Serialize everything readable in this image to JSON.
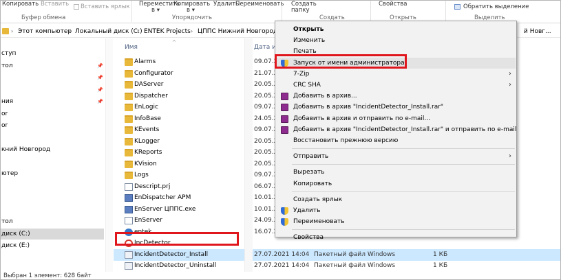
{
  "ribbon": {
    "items": [
      {
        "text": "Копировать",
        "grey": false
      },
      {
        "text": "Вставить",
        "grey": true
      },
      {
        "text": "Вставить ярлык",
        "grey": true
      },
      {
        "text": "Переместить",
        "grey": false
      },
      {
        "text": "Копировать",
        "grey": false
      },
      {
        "text": "в ▾",
        "grey": false
      },
      {
        "text": "в ▾",
        "grey": false
      },
      {
        "text": "Удалить",
        "grey": false
      },
      {
        "text": "Переименовать",
        "grey": false
      },
      {
        "text": "Создать",
        "grey": false
      },
      {
        "text": "папку",
        "grey": false
      },
      {
        "text": "Свойства",
        "grey": false
      },
      {
        "text": "Обратить выделение",
        "grey": false
      }
    ],
    "groups": [
      "Буфер обмена",
      "Упорядочить",
      "Создать",
      "Открыть",
      "Выделить"
    ]
  },
  "address": {
    "crumbs": [
      "Этот компьютер",
      "Локальный диск (C:)",
      "ENTEK Projects",
      "ЦППС Нижний Новгород"
    ],
    "right_text": "й Новг..."
  },
  "nav": {
    "items": [
      {
        "label": "ступ",
        "pinned": false,
        "selected": false
      },
      {
        "label": "тол",
        "pinned": true,
        "selected": false
      },
      {
        "label": "",
        "pinned": true,
        "selected": false
      },
      {
        "label": "",
        "pinned": true,
        "selected": false
      },
      {
        "label": "ния",
        "pinned": true,
        "selected": false
      },
      {
        "label": "or",
        "pinned": false,
        "selected": false
      },
      {
        "label": "or",
        "pinned": false,
        "selected": false
      },
      {
        "label": "",
        "pinned": false,
        "selected": false
      },
      {
        "label": "кний Новгород",
        "pinned": false,
        "selected": false
      },
      {
        "label": "",
        "pinned": false,
        "selected": false
      },
      {
        "label": "ютер",
        "pinned": false,
        "selected": false
      },
      {
        "label": "",
        "pinned": false,
        "selected": false
      },
      {
        "label": "",
        "pinned": false,
        "selected": false
      },
      {
        "label": "",
        "pinned": false,
        "selected": false
      },
      {
        "label": "тол",
        "pinned": false,
        "selected": false
      },
      {
        "label": "диск (C:)",
        "pinned": false,
        "selected": true
      },
      {
        "label": "диск (E:)",
        "pinned": false,
        "selected": false
      }
    ]
  },
  "list": {
    "columns": {
      "name": "Имя",
      "date": "Дата из"
    },
    "rows": [
      {
        "name": "Alarms",
        "date": "09.07.20",
        "type": "",
        "size": "",
        "icon": "folder"
      },
      {
        "name": "Configurator",
        "date": "21.07.20",
        "type": "",
        "size": "",
        "icon": "folder"
      },
      {
        "name": "DAServer",
        "date": "20.05.20",
        "type": "",
        "size": "",
        "icon": "folder"
      },
      {
        "name": "Dispatcher",
        "date": "20.05.20",
        "type": "",
        "size": "",
        "icon": "folder"
      },
      {
        "name": "EnLogic",
        "date": "09.07.20",
        "type": "",
        "size": "",
        "icon": "folder"
      },
      {
        "name": "InfoBase",
        "date": "24.05.20",
        "type": "",
        "size": "",
        "icon": "folder"
      },
      {
        "name": "KEvents",
        "date": "09.07.20",
        "type": "",
        "size": "",
        "icon": "folder"
      },
      {
        "name": "KLogger",
        "date": "20.05.20",
        "type": "",
        "size": "",
        "icon": "folder"
      },
      {
        "name": "KReports",
        "date": "20.05.20",
        "type": "",
        "size": "",
        "icon": "folder"
      },
      {
        "name": "KVision",
        "date": "20.05.20",
        "type": "",
        "size": "",
        "icon": "folder"
      },
      {
        "name": "Logs",
        "date": "09.07.20",
        "type": "",
        "size": "",
        "icon": "folder"
      },
      {
        "name": "Descript.prj",
        "date": "06.07.20",
        "type": "",
        "size": "",
        "icon": "doc"
      },
      {
        "name": "EnDispatcher APM",
        "date": "10.01.20",
        "type": "",
        "size": "",
        "icon": "exe"
      },
      {
        "name": "EnServer ЦППС.exe",
        "date": "10.01.20",
        "type": "",
        "size": "",
        "icon": "exe"
      },
      {
        "name": "EnServer",
        "date": "24.09.20",
        "type": "",
        "size": "",
        "icon": "doc"
      },
      {
        "name": "entek",
        "date": "16.07.20",
        "type": "",
        "size": "",
        "icon": "blue"
      },
      {
        "name": "IncDetector",
        "date": "",
        "type": "",
        "size": "",
        "icon": "red"
      },
      {
        "name": "IncidentDetector_Install",
        "date": "27.07.2021 14:04",
        "type": "Пакетный файл Windows",
        "size": "1 КБ",
        "icon": "bat",
        "highlight": true
      },
      {
        "name": "IncidentDetector_Uninstall",
        "date": "27.07.2021 14:04",
        "type": "Пакетный файл Windows",
        "size": "1 КБ",
        "icon": "bat"
      }
    ]
  },
  "status": {
    "text": "Выбран 1 элемент: 628 байт"
  },
  "menu": {
    "items": [
      {
        "label": "Открыть",
        "bold": true,
        "icon": "",
        "arrow": false
      },
      {
        "label": "Изменить",
        "bold": false,
        "icon": "",
        "arrow": false
      },
      {
        "label": "Печать",
        "bold": false,
        "icon": "",
        "arrow": false
      },
      {
        "label": "Запуск от имени администратора",
        "bold": false,
        "icon": "shield",
        "arrow": false,
        "hover": true
      },
      {
        "label": "7-Zip",
        "bold": false,
        "icon": "",
        "arrow": true
      },
      {
        "label": "CRC SHA",
        "bold": false,
        "icon": "",
        "arrow": true
      },
      {
        "label": "Добавить в архив...",
        "bold": false,
        "icon": "rar",
        "arrow": false
      },
      {
        "label": "Добавить в архив \"IncidentDetector_Install.rar\"",
        "bold": false,
        "icon": "rar",
        "arrow": false
      },
      {
        "label": "Добавить в архив и отправить по e-mail...",
        "bold": false,
        "icon": "rar",
        "arrow": false
      },
      {
        "label": "Добавить в архив \"IncidentDetector_Install.rar\" и отправить по e-mail",
        "bold": false,
        "icon": "rar",
        "arrow": false
      },
      {
        "label": "Восстановить прежнюю версию",
        "bold": false,
        "icon": "",
        "arrow": false
      },
      {
        "separator": true
      },
      {
        "label": "Отправить",
        "bold": false,
        "icon": "",
        "arrow": true
      },
      {
        "separator": true
      },
      {
        "label": "Вырезать",
        "bold": false,
        "icon": "",
        "arrow": false
      },
      {
        "label": "Копировать",
        "bold": false,
        "icon": "",
        "arrow": false
      },
      {
        "separator": true
      },
      {
        "label": "Создать ярлык",
        "bold": false,
        "icon": "",
        "arrow": false
      },
      {
        "label": "Удалить",
        "bold": false,
        "icon": "shield",
        "arrow": false
      },
      {
        "label": "Переименовать",
        "bold": false,
        "icon": "shield",
        "arrow": false
      },
      {
        "separator": true
      },
      {
        "label": "Свойства",
        "bold": false,
        "icon": "",
        "arrow": false
      }
    ]
  }
}
